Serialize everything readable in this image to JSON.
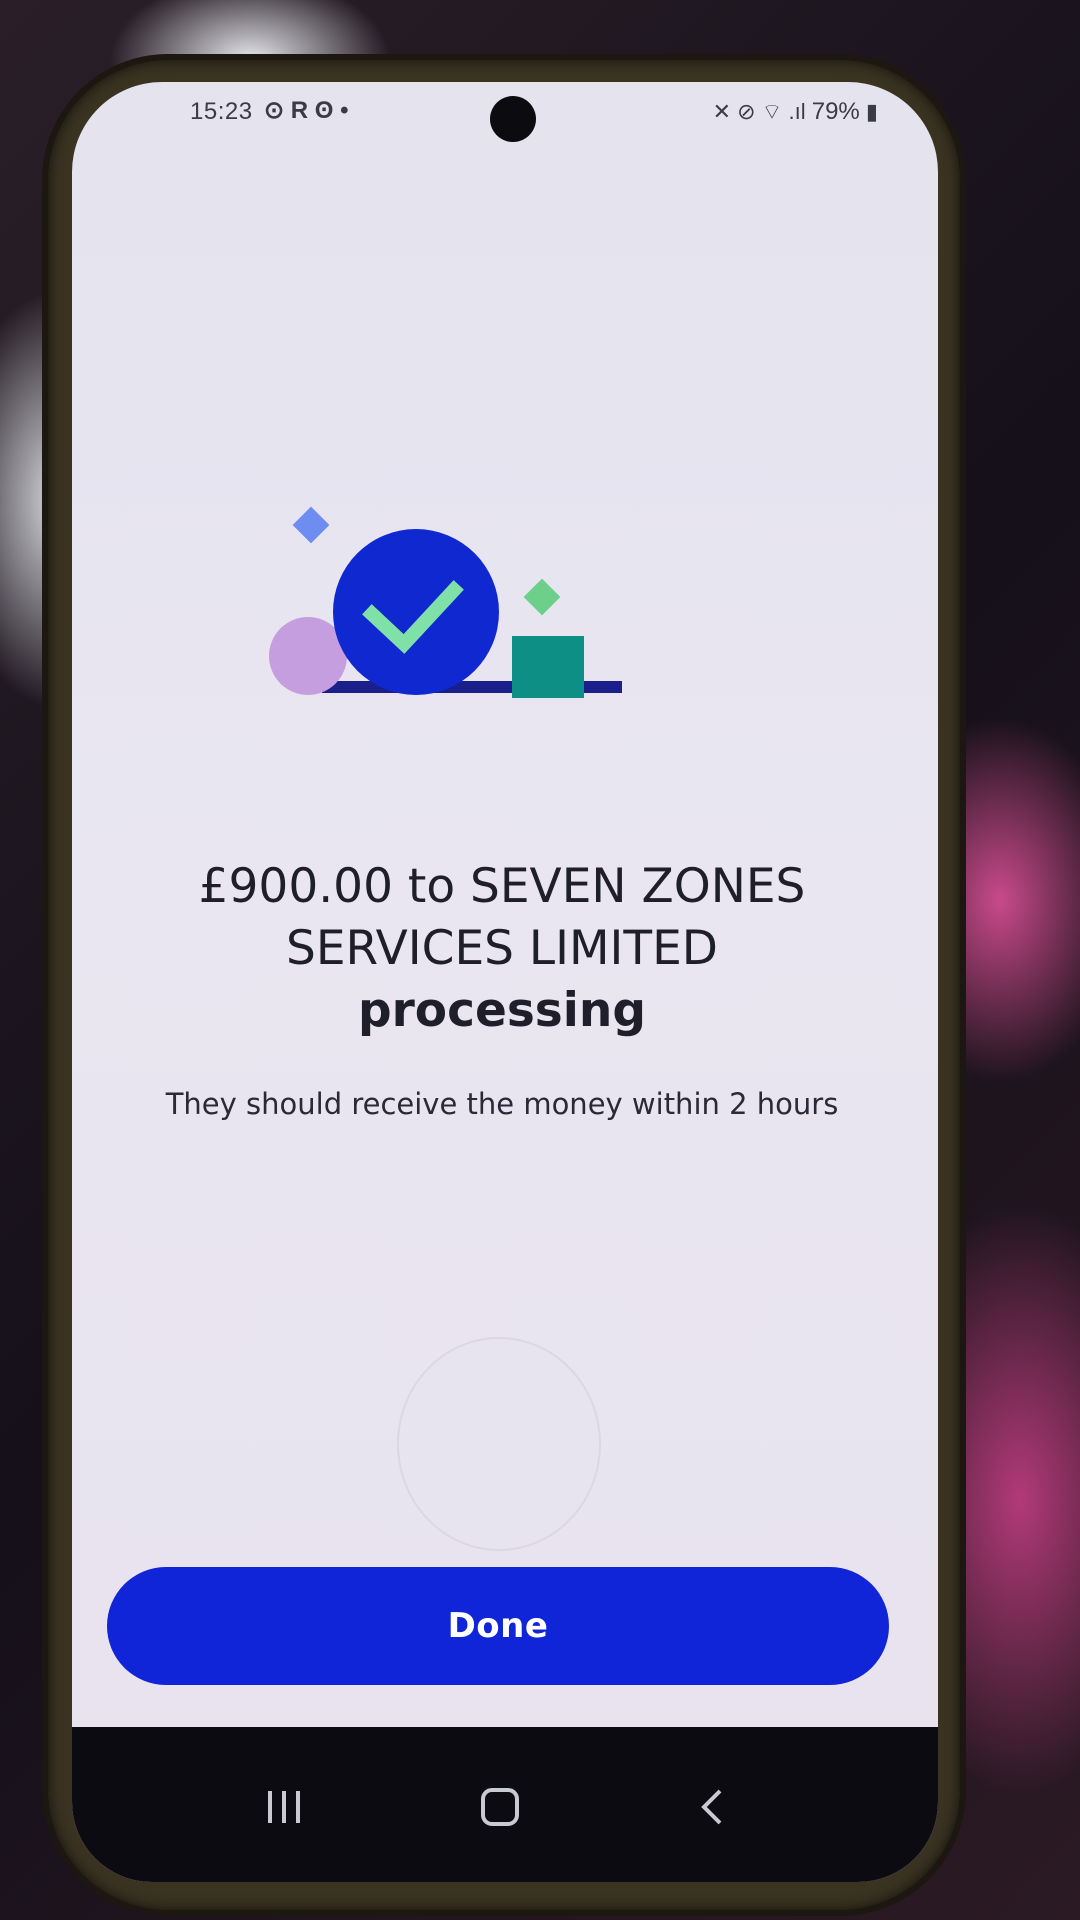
{
  "status_bar": {
    "time": "15:23",
    "app_icons": "⊙ R ʘ •",
    "right_icons": "✕ ⊘ ⌔ .ıl",
    "battery": "79%"
  },
  "colors": {
    "primary_button": "#1024d8",
    "check_circle": "#1028d0",
    "check_mark": "#7fe0a8",
    "pink_circle": "#c59ee0",
    "teal_square": "#0e8f86",
    "blue_diamond": "#6d8ef0",
    "green_diamond": "#6cd08a",
    "underline_bar": "#1a1f8c"
  },
  "illustration": {
    "icons": [
      "check-circle-icon",
      "blue-diamond-icon",
      "green-diamond-icon",
      "pink-circle-icon",
      "teal-square-icon"
    ]
  },
  "transfer": {
    "headline_line1": "£900.00 to SEVEN ZONES",
    "headline_line2": "SERVICES LIMITED",
    "headline_line3": "processing",
    "subtext": "They should receive the money within 2 hours"
  },
  "actions": {
    "done_label": "Done"
  },
  "nav": {
    "icons": [
      "recent-apps-icon",
      "home-icon",
      "back-icon"
    ]
  }
}
